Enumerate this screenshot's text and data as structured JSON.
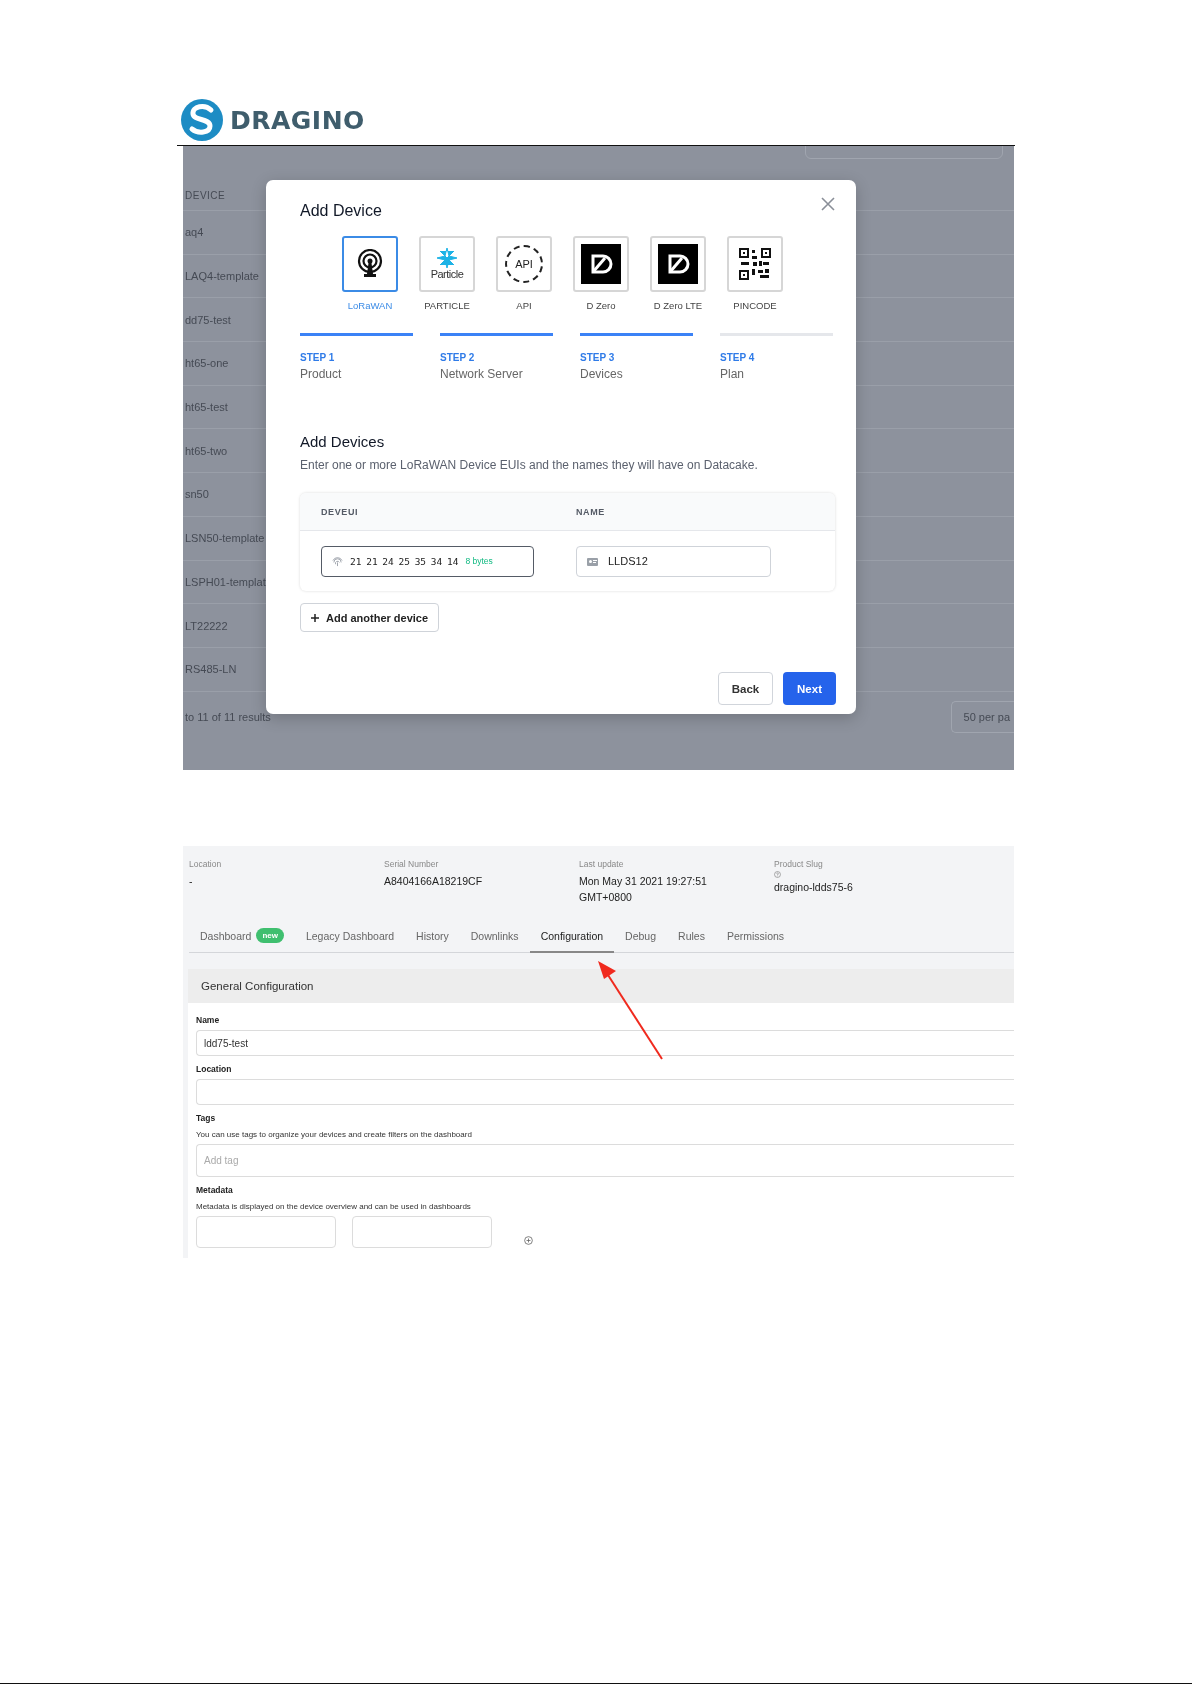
{
  "logo": {
    "text": "DRAGINO"
  },
  "add_device_screenshot": {
    "background_table": {
      "column": "DEVICE",
      "rows": [
        "aq4",
        "LAQ4-template",
        "dd75-test",
        "ht65-one",
        "ht65-test",
        "ht65-two",
        "sn50",
        "LSN50-template",
        "LSPH01-templat",
        "LT22222",
        "RS485-LN"
      ],
      "footer": "to 11 of 11 results",
      "per_page": "50 per pa"
    },
    "modal": {
      "title": "Add Device",
      "sources": [
        {
          "label": "LoRaWAN",
          "kind": "lorawan",
          "selected": true
        },
        {
          "label": "PARTICLE",
          "kind": "particle",
          "logo_text": "Particle",
          "selected": false
        },
        {
          "label": "API",
          "kind": "api",
          "logo_text": "API",
          "selected": false
        },
        {
          "label": "D Zero",
          "kind": "dzero",
          "selected": false
        },
        {
          "label": "D Zero LTE",
          "kind": "dzero",
          "selected": false
        },
        {
          "label": "PINCODE",
          "kind": "qr",
          "selected": false
        }
      ],
      "steps": [
        {
          "step": "STEP 1",
          "label": "Product",
          "done": true
        },
        {
          "step": "STEP 2",
          "label": "Network Server",
          "done": true
        },
        {
          "step": "STEP 3",
          "label": "Devices",
          "done": true
        },
        {
          "step": "STEP 4",
          "label": "Plan",
          "done": false
        }
      ],
      "section_title": "Add Devices",
      "description": "Enter one or more LoRaWAN Device EUIs and the names they will have on Datacake.",
      "table": {
        "columns": [
          "DEVEUI",
          "NAME"
        ],
        "rows": [
          {
            "deveui": "21 21 24 25 35 34 14",
            "byte_count": "8 bytes",
            "name": "LLDS12"
          }
        ]
      },
      "add_button": "Add another device",
      "back_button": "Back",
      "next_button": "Next"
    }
  },
  "device_screenshot": {
    "info": [
      {
        "label": "Location",
        "value": "-",
        "help": false
      },
      {
        "label": "Serial Number",
        "value": "A8404166A18219CF",
        "help": false
      },
      {
        "label": "Last update",
        "value": "Mon May 31 2021 19:27:51 GMT+0800",
        "help": false
      },
      {
        "label": "Product Slug",
        "value": "dragino-ldds75-6",
        "help": true
      }
    ],
    "tabs": [
      {
        "label": "Dashboard",
        "badge": "new",
        "selected": false
      },
      {
        "label": "Legacy Dashboard",
        "selected": false
      },
      {
        "label": "History",
        "selected": false
      },
      {
        "label": "Downlinks",
        "selected": false
      },
      {
        "label": "Configuration",
        "selected": true
      },
      {
        "label": "Debug",
        "selected": false
      },
      {
        "label": "Rules",
        "selected": false
      },
      {
        "label": "Permissions",
        "selected": false
      }
    ],
    "section_title": "General Configuration",
    "fields": [
      {
        "kind": "text",
        "label": "Name",
        "value": "ldd75-test"
      },
      {
        "kind": "text",
        "label": "Location"
      },
      {
        "kind": "tags",
        "label": "Tags",
        "hint": "You can use tags to organize your devices and create filters on the dashboard",
        "placeholder": "Add tag"
      },
      {
        "kind": "metadata",
        "label": "Metadata",
        "hint": "Metadata is displayed on the device overview and can be used in dashboards"
      }
    ]
  }
}
